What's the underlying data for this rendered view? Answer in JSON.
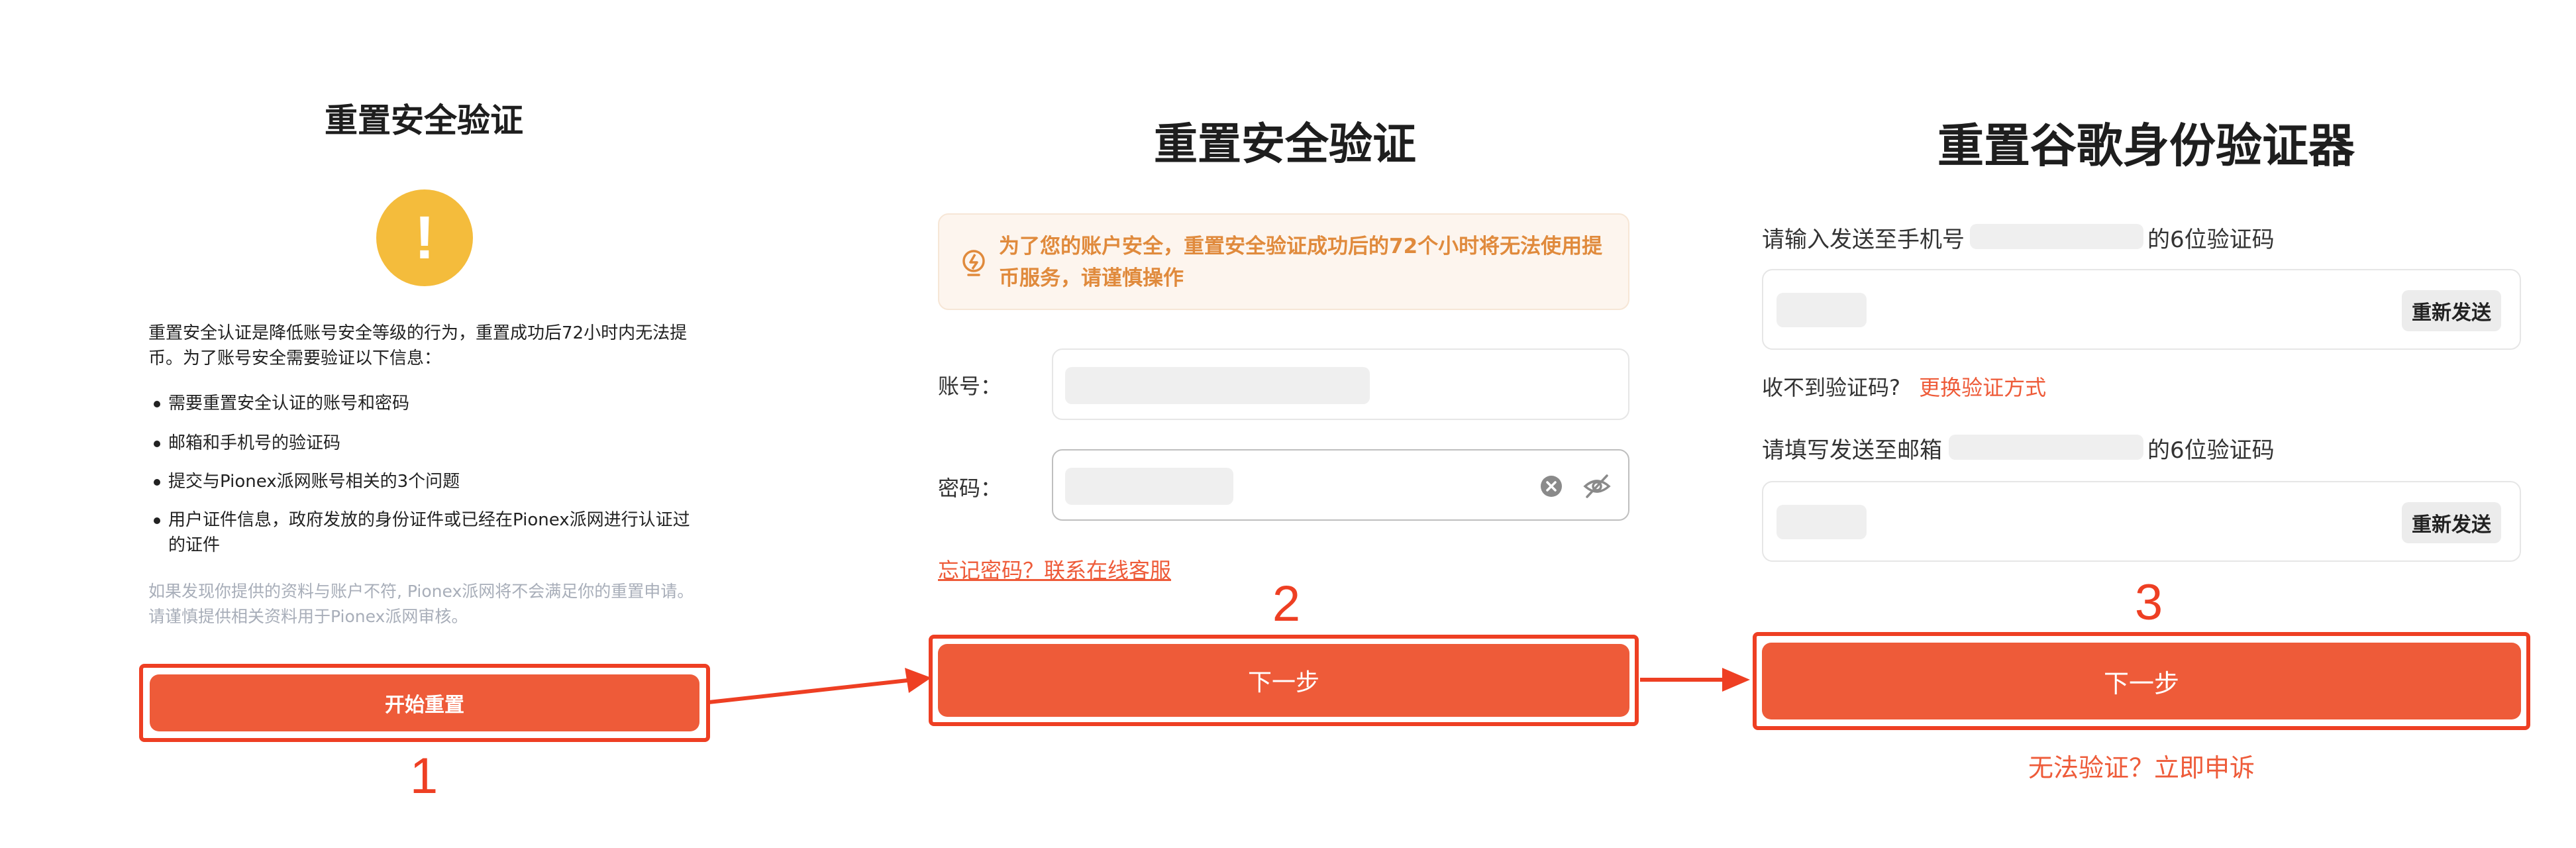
{
  "panel1": {
    "title": "重置安全验证",
    "alert_glyph": "!",
    "intro": "重置安全认证是降低账号安全等级的行为，重置成功后72小时内无法提币。为了账号安全需要验证以下信息：",
    "bullets": [
      "需要重置安全认证的账号和密码",
      "邮箱和手机号的验证码",
      "提交与Pionex派网账号相关的3个问题",
      "用户证件信息，政府发放的身份证件或已经在Pionex派网进行认证过的证件"
    ],
    "note": "如果发现你提供的资料与账户不符, Pionex派网将不会满足你的重置申请。请谨慎提供相关资料用于Pionex派网审核。",
    "button": "开始重置",
    "step": "1"
  },
  "panel2": {
    "title": "重置安全验证",
    "warning": "为了您的账户安全，重置安全验证成功后的72个小时将无法使用提币服务，请谨慎操作",
    "account_label": "账号：",
    "password_label": "密码：",
    "forgot_link": "忘记密码？联系在线客服",
    "button": "下一步",
    "step": "2"
  },
  "panel3": {
    "title": "重置谷歌身份验证器",
    "phone_prefix": "请输入发送至手机号",
    "phone_suffix": "的6位验证码",
    "resend": "重新发送",
    "no_code": "收不到验证码?",
    "switch_method": "更换验证方式",
    "email_prefix": "请填写发送至邮箱",
    "email_suffix": "的6位验证码",
    "button": "下一步",
    "step": "3",
    "appeal": "无法验证？立即申诉"
  },
  "colors": {
    "accent": "#ee5b39",
    "annotation_red": "#ee3f23",
    "warning_bg": "#fdf5ee",
    "warning_text": "#e08a3c",
    "alert_yellow": "#f4bc3c"
  }
}
